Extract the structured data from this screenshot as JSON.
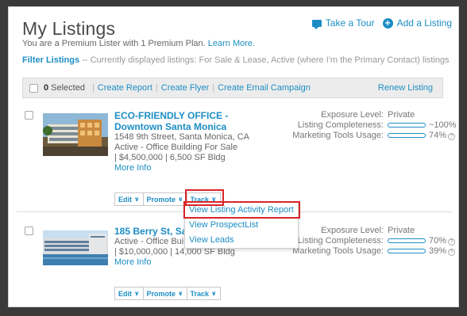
{
  "header": {
    "title": "My Listings",
    "take_tour": "Take a Tour",
    "add_listing": "Add a Listing"
  },
  "premium": {
    "text": "You are a Premium Lister with 1 Premium Plan.",
    "learn_more": "Learn More."
  },
  "filter": {
    "label": "Filter Listings",
    "text": "-- Currently displayed listings: For Sale & Lease, Active (where I'm the Primary Contact) listings"
  },
  "toolbar": {
    "selected_count": "0",
    "selected_label": "Selected",
    "create_report": "Create Report",
    "create_flyer": "Create Flyer",
    "create_email_campaign": "Create Email Campaign",
    "renew_listing": "Renew Listing"
  },
  "listings": [
    {
      "title": "ECO-FRIENDLY OFFICE - Downtown Santa Monica",
      "address": "1548 9th Street, Santa Monica, CA",
      "status": "Active - Office Building For Sale",
      "details": "| $4,500,000 | 6,500 SF Bldg",
      "more_info": "More Info",
      "exposure_label": "Exposure Level:",
      "exposure_value": "Private",
      "completeness_label": "Listing Completeness:",
      "completeness_pct": "~100%",
      "completeness_fill": 1.0,
      "marketing_label": "Marketing Tools Usage:",
      "marketing_pct": "74%",
      "marketing_fill": 0.74
    },
    {
      "title": "185 Berry St, San F",
      "status": "Active - Office Build",
      "details": "| $10,000,000 | 14,000 SF Bldg",
      "more_info": "More Info",
      "exposure_label": "Exposure Level:",
      "exposure_value": "Private",
      "completeness_label": "Listing Completeness:",
      "completeness_pct": "70%",
      "completeness_fill": 0.7,
      "marketing_label": "Marketing Tools Usage:",
      "marketing_pct": "39%",
      "marketing_fill": 0.39
    }
  ],
  "buttons": {
    "edit": "Edit",
    "promote": "Promote",
    "track": "Track"
  },
  "track_menu": {
    "items": [
      "View Listing Activity Report",
      "View ProspectList",
      "View Leads"
    ]
  },
  "colors": {
    "accent": "#1d8ec4",
    "highlight": "#d9252a"
  }
}
